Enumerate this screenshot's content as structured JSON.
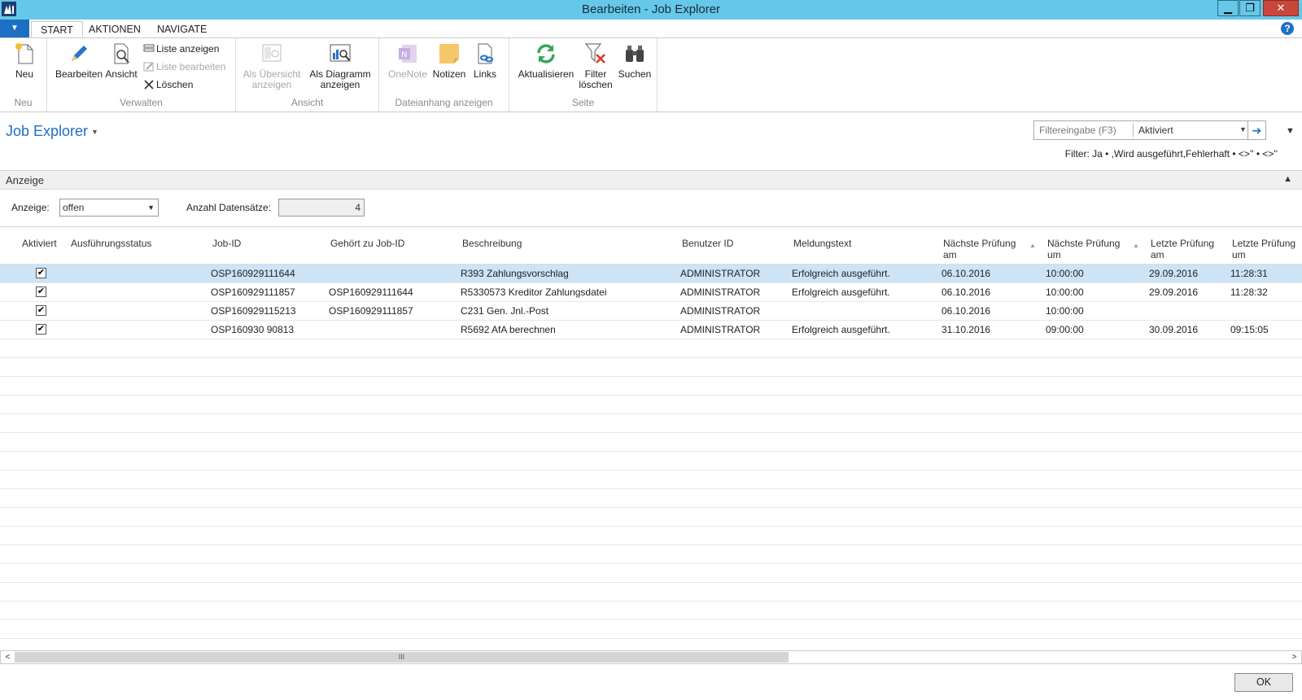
{
  "window": {
    "title": "Bearbeiten - Job Explorer",
    "minimize": "▁",
    "restore": "❐",
    "close": "✕"
  },
  "tabs": [
    "START",
    "AKTIONEN",
    "NAVIGATE"
  ],
  "help": "?",
  "ribbon": {
    "neu": {
      "label": "Neu",
      "group": "Neu"
    },
    "verwalten": {
      "group": "Verwalten",
      "bearbeiten": "Bearbeiten",
      "ansicht": "Ansicht",
      "liste_anzeigen": "Liste anzeigen",
      "liste_bearbeiten": "Liste bearbeiten",
      "loeschen": "Löschen"
    },
    "ansicht_group": {
      "group": "Ansicht",
      "uebersicht_l1": "Als Übersicht",
      "uebersicht_l2": "anzeigen",
      "diagramm_l1": "Als Diagramm",
      "diagramm_l2": "anzeigen"
    },
    "datei": {
      "group": "Dateianhang anzeigen",
      "onenote": "OneNote",
      "notizen": "Notizen",
      "links": "Links"
    },
    "seite": {
      "group": "Seite",
      "aktualisieren": "Aktualisieren",
      "filter_l1": "Filter",
      "filter_l2": "löschen",
      "suchen": "Suchen"
    }
  },
  "page": {
    "title": "Job Explorer",
    "filter_placeholder": "Filtereingabe (F3)",
    "filter_field": "Aktiviert",
    "filter_text": "Filter: Ja • ,Wird ausgeführt,Fehlerhaft • <>'' • <>''"
  },
  "anzeige": {
    "title": "Anzeige",
    "label": "Anzeige:",
    "value": "offen",
    "count_label": "Anzahl Datensätze:",
    "count": "4"
  },
  "grid": {
    "headers": {
      "aktiviert": "Aktiviert",
      "status": "Ausführungsstatus",
      "jobid": "Job-ID",
      "parent": "Gehört zu Job-ID",
      "desc": "Beschreibung",
      "user": "Benutzer ID",
      "msg": "Meldungstext",
      "next_date_l1": "Nächste Prüfung",
      "next_date_l2": "am",
      "next_time_l1": "Nächste Prüfung",
      "next_time_l2": "um",
      "last_date_l1": "Letzte Prüfung",
      "last_date_l2": "am",
      "last_time_l1": "Letzte Prüfung",
      "last_time_l2": "um"
    },
    "rows": [
      {
        "checked": "✔",
        "jobid": "OSP160929111644",
        "parent": "",
        "desc": "R393 Zahlungsvorschlag",
        "user": "ADMINISTRATOR",
        "msg": "Erfolgreich ausgeführt.",
        "next_date": "06.10.2016",
        "next_time": "10:00:00",
        "last_date": "29.09.2016",
        "last_time": "11:28:31"
      },
      {
        "checked": "✔",
        "jobid": "OSP160929111857",
        "parent": "OSP160929111644",
        "desc": "R5330573 Kreditor Zahlungsdatei",
        "user": "ADMINISTRATOR",
        "msg": "Erfolgreich ausgeführt.",
        "next_date": "06.10.2016",
        "next_time": "10:00:00",
        "last_date": "29.09.2016",
        "last_time": "11:28:32"
      },
      {
        "checked": "✔",
        "jobid": "OSP160929115213",
        "parent": "OSP160929111857",
        "desc": "C231 Gen. Jnl.-Post",
        "user": "ADMINISTRATOR",
        "msg": "",
        "next_date": "06.10.2016",
        "next_time": "10:00:00",
        "last_date": "",
        "last_time": ""
      },
      {
        "checked": "✔",
        "jobid": "OSP160930 90813",
        "parent": "",
        "desc": "R5692 AfA berechnen",
        "user": "ADMINISTRATOR",
        "msg": "Erfolgreich ausgeführt.",
        "next_date": "31.10.2016",
        "next_time": "09:00:00",
        "last_date": "30.09.2016",
        "last_time": "09:15:05"
      }
    ]
  },
  "scroll": {
    "left": "<",
    "right": ">",
    "grip": "III"
  },
  "ok": "OK",
  "colors": {
    "titlebar": "#66c8e8",
    "accent": "#1d6fc4",
    "selected_row": "#cde3f6"
  }
}
